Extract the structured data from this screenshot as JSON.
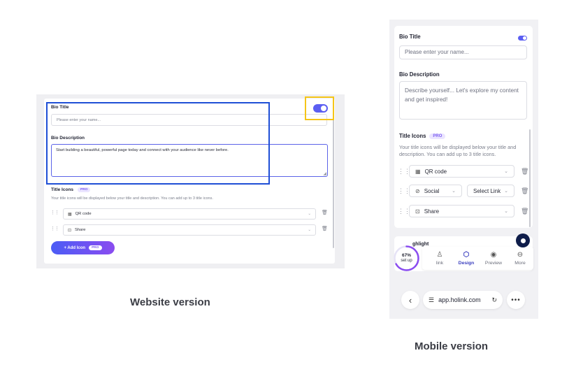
{
  "website": {
    "bio_title_label": "Bio Title",
    "bio_title_placeholder": "Please enter your name...",
    "bio_description_label": "Bio Description",
    "bio_description_value": "Start building a beautiful, powerful page today and connect with your audience like never before.",
    "title_icons_label": "Title Icons",
    "pro_badge": "PRO",
    "title_icons_help": "Your title icons will be displayed below your title and description. You can add up to 3 title icons.",
    "rows": [
      {
        "label": "QR code",
        "icon": "qr-code-icon"
      },
      {
        "label": "Share",
        "icon": "share-icon"
      }
    ],
    "add_icon_label": "+ Add Icon",
    "add_icon_badge": "PRO",
    "toggle_on": true
  },
  "mobile": {
    "bio_title_label": "Bio Title",
    "bio_title_placeholder": "Please enter your name...",
    "bio_description_label": "Bio Description",
    "bio_description_placeholder": "Describe yourself... Let's explore my content and get inspired!",
    "title_icons_label": "Title Icons",
    "pro_badge": "PRO",
    "title_icons_help": "Your title icons will be displayed below your title and description. You can add up to 3 title icons.",
    "rows": [
      {
        "label": "QR code",
        "icon": "qr-code-icon"
      },
      {
        "label": "Social",
        "icon": "social-icon",
        "second": "Select Link"
      },
      {
        "label": "Share",
        "icon": "share-icon"
      }
    ],
    "partial_text": "ghlight",
    "setup_percent": "67%",
    "setup_label": "set up",
    "setup_progress": 0.67,
    "nav": [
      {
        "label": "link",
        "icon": "user-icon"
      },
      {
        "label": "Design",
        "icon": "design-icon",
        "active": true
      },
      {
        "label": "Preview",
        "icon": "eye-icon"
      },
      {
        "label": "More",
        "icon": "more-icon"
      }
    ],
    "url": "app.holink.com",
    "toggle_on": true
  },
  "captions": {
    "website": "Website version",
    "mobile": "Mobile version"
  },
  "colors": {
    "accent": "#5b5ef2",
    "highlight_blue": "#1f4fd6",
    "highlight_yellow": "#f5c518",
    "gradient_start": "#4b5cf5",
    "gradient_end": "#8a4cf0"
  }
}
